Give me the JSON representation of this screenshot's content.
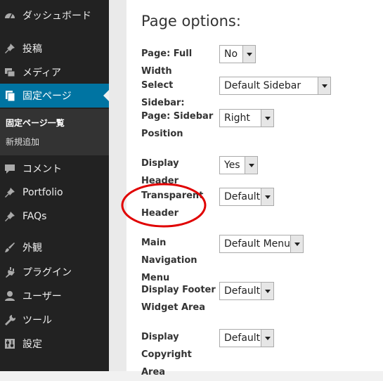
{
  "sidebar": {
    "items": [
      {
        "label": "ダッシュボード",
        "icon": "dashboard-icon"
      },
      {
        "label": "投稿",
        "icon": "pin-icon"
      },
      {
        "label": "メディア",
        "icon": "media-icon"
      },
      {
        "label": "固定ページ",
        "icon": "pages-icon",
        "current": true
      },
      {
        "label": "コメント",
        "icon": "comment-icon"
      },
      {
        "label": "Portfolio",
        "icon": "pin-icon"
      },
      {
        "label": "FAQs",
        "icon": "pin-icon"
      },
      {
        "label": "外観",
        "icon": "brush-icon"
      },
      {
        "label": "プラグイン",
        "icon": "plugin-icon"
      },
      {
        "label": "ユーザー",
        "icon": "user-icon"
      },
      {
        "label": "ツール",
        "icon": "wrench-icon"
      },
      {
        "label": "設定",
        "icon": "settings-icon"
      }
    ],
    "submenu": [
      {
        "label": "固定ページ一覧",
        "active": true
      },
      {
        "label": "新規追加"
      }
    ]
  },
  "page_options": {
    "title": "Page options:",
    "options": [
      {
        "label": "Page: Full Width",
        "value": "No"
      },
      {
        "label": "Select Sidebar:",
        "value": "Default Sidebar"
      },
      {
        "label": "Page: Sidebar Position",
        "value": "Right"
      },
      {
        "label": "Display Header",
        "value": "Yes"
      },
      {
        "label": "Transparent Header",
        "value": "Default",
        "highlighted": true
      },
      {
        "label": "Main Navigation Menu",
        "value": "Default Menu"
      },
      {
        "label": "Display Footer Widget Area",
        "value": "Default"
      },
      {
        "label": "Display Copyright Area",
        "value": "Default"
      }
    ]
  },
  "colors": {
    "sidebar_bg": "#222222",
    "current_item_bg": "#0074a2",
    "highlight_circle": "#e00000"
  }
}
